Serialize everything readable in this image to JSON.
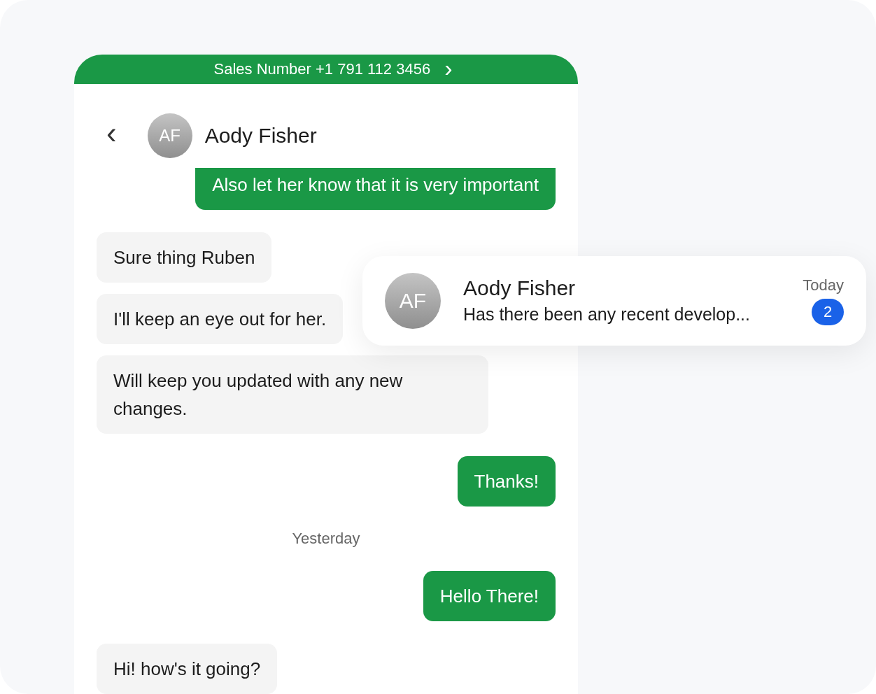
{
  "banner": {
    "label": "Sales Number +1 791 112 3456",
    "arrow": "›"
  },
  "chat": {
    "back": "‹",
    "initials": "AF",
    "name": "Aody Fisher"
  },
  "messages": [
    {
      "kind": "sent",
      "text": "Also let her know that it is very important"
    },
    {
      "kind": "received",
      "text": "Sure thing Ruben"
    },
    {
      "kind": "received",
      "text": "I'll keep an eye out for her."
    },
    {
      "kind": "received",
      "text": "Will keep you updated with any new changes."
    },
    {
      "kind": "sent",
      "text": "Thanks!"
    },
    {
      "kind": "date",
      "text": "Yesterday"
    },
    {
      "kind": "sent",
      "text": "Hello There!"
    },
    {
      "kind": "received",
      "text": "Hi! how's it going?"
    }
  ],
  "notification": {
    "initials": "AF",
    "name": "Aody Fisher",
    "preview": "Has there been any recent develop...",
    "time": "Today",
    "unread": "2"
  }
}
